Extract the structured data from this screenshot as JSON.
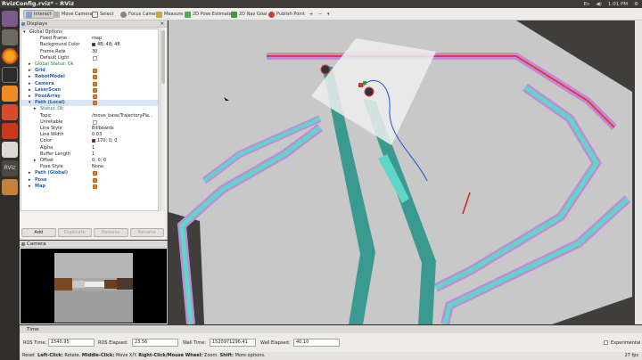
{
  "window": {
    "title": "RvizConfig.rviz* - RViz",
    "clock": "1:01 PM",
    "tray": [
      "En",
      "◀)",
      "⚙"
    ]
  },
  "toolbar": {
    "items": [
      "Interact",
      "Move Camera",
      "Select",
      "Focus Camera",
      "Measure",
      "2D Pose Estimate",
      "2D Nav Goal",
      "Publish Point"
    ],
    "extras": [
      "+",
      "−",
      "▾"
    ]
  },
  "displays": {
    "title": "Displays",
    "rows": [
      {
        "k": "Global Options",
        "v": "",
        "indent": 0,
        "exp": "▾"
      },
      {
        "k": "Fixed Frame",
        "v": "map",
        "indent": 2
      },
      {
        "k": "Background Color",
        "v": "48; 48; 48",
        "indent": 2,
        "swatch": "#303030"
      },
      {
        "k": "Frame Rate",
        "v": "30",
        "indent": 2
      },
      {
        "k": "Default Light",
        "v": "",
        "indent": 2,
        "check": "empty"
      },
      {
        "k": "Global Status: Ok",
        "v": "",
        "indent": 1,
        "exp": "▸",
        "tick": true
      },
      {
        "k": "Grid",
        "v": "",
        "indent": 1,
        "exp": "▸",
        "blue": true,
        "check": "on"
      },
      {
        "k": "RobotModel",
        "v": "",
        "indent": 1,
        "exp": "▸",
        "blue": true,
        "check": "on"
      },
      {
        "k": "Camera",
        "v": "",
        "indent": 1,
        "exp": "▸",
        "blue": true,
        "check": "on"
      },
      {
        "k": "LaserScan",
        "v": "",
        "indent": 1,
        "exp": "▸",
        "blue": true,
        "check": "on"
      },
      {
        "k": "PoseArray",
        "v": "",
        "indent": 1,
        "exp": "▸",
        "blue": true,
        "check": "on"
      },
      {
        "k": "Path (Local)",
        "v": "",
        "indent": 1,
        "exp": "▾",
        "blue": true,
        "check": "on",
        "sel": true
      },
      {
        "k": "Status: Ok",
        "v": "",
        "indent": 2,
        "exp": "▸",
        "tick": true
      },
      {
        "k": "Topic",
        "v": "/move_base/TrajectoryPla...",
        "indent": 2
      },
      {
        "k": "Unreliable",
        "v": "",
        "indent": 2,
        "check": "empty"
      },
      {
        "k": "Line Style",
        "v": "Billboards",
        "indent": 2
      },
      {
        "k": "Line Width",
        "v": "0.03",
        "indent": 2
      },
      {
        "k": "Color",
        "v": "170; 0; 0",
        "indent": 2,
        "swatch": "#aa0000"
      },
      {
        "k": "Alpha",
        "v": "1",
        "indent": 2
      },
      {
        "k": "Buffer Length",
        "v": "1",
        "indent": 2
      },
      {
        "k": "Offset",
        "v": "0; 0; 0",
        "indent": 2,
        "exp": "▸"
      },
      {
        "k": "Pose Style",
        "v": "None",
        "indent": 2
      },
      {
        "k": "Path (Global)",
        "v": "",
        "indent": 1,
        "exp": "▸",
        "blue": true,
        "check": "on"
      },
      {
        "k": "Pose",
        "v": "",
        "indent": 1,
        "exp": "▸",
        "blue": true,
        "check": "on"
      },
      {
        "k": "Map",
        "v": "",
        "indent": 1,
        "exp": "▸",
        "blue": true,
        "check": "on"
      }
    ],
    "buttons": [
      {
        "label": "Add",
        "enabled": true
      },
      {
        "label": "Duplicate",
        "enabled": false
      },
      {
        "label": "Remove",
        "enabled": false
      },
      {
        "label": "Rename",
        "enabled": false
      }
    ]
  },
  "camera_panel": {
    "title": "Camera"
  },
  "time": {
    "title": "Time",
    "ros_time_label": "ROS Time:",
    "ros_time": "1540.95",
    "ros_elapsed_label": "ROS Elapsed:",
    "ros_elapsed": "23.56",
    "wall_time_label": "Wall Time:",
    "wall_time": "1520971296.41",
    "wall_elapsed_label": "Wall Elapsed:",
    "wall_elapsed": "40.10",
    "experimental_label": "Experimental"
  },
  "status": {
    "prefix": "Reset",
    "hint_left_key": "Left-Click:",
    "hint_left": "Rotate.",
    "hint_mid_key": "Middle-Click:",
    "hint_mid": "Move X/Y.",
    "hint_right_key": "Right-Click/Mouse Wheel:",
    "hint_right": "Zoom.",
    "hint_shift_key": "Shift:",
    "hint_shift": "More options.",
    "fps": "27 fps"
  },
  "colors": {
    "accent": "#e87a2a",
    "selected_row": "#d9e4f2",
    "map_free": "#c8c8c8",
    "map_background": "#3f3e3b",
    "costmap_teal": "#5fd7c8",
    "costmap_purple": "#c28ad8",
    "path_local": "#aa0000",
    "path_global": "#1e4fd8"
  },
  "icons": {
    "launcher": [
      "dash-icon",
      "files-icon",
      "firefox-icon",
      "terminal-icon",
      "sublime-icon",
      "impress-icon",
      "settings-icon",
      "rviz-icon",
      "box-icon"
    ]
  }
}
